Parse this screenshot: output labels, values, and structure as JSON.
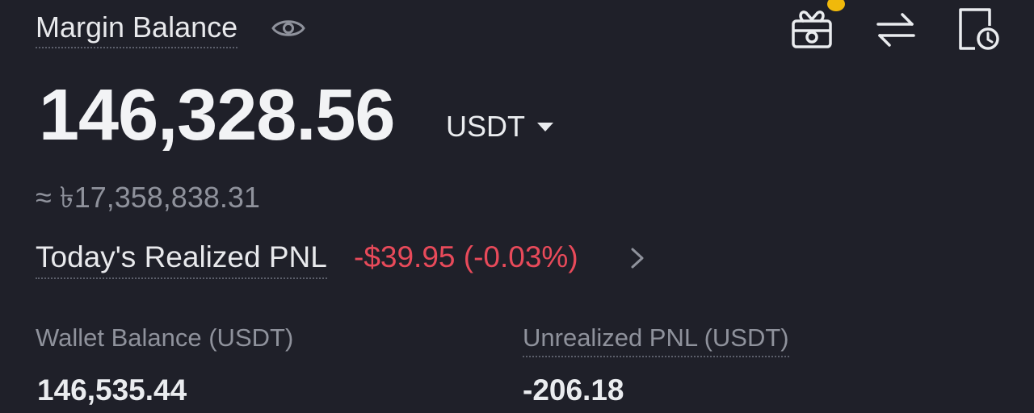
{
  "header": {
    "margin_balance_label": "Margin Balance",
    "notification_color": "#f0b90b"
  },
  "icons": {
    "visibility": "eye-icon",
    "rewards": "gift-icon",
    "transfer": "transfer-icon",
    "history": "history-icon",
    "currency_dropdown": "caret-down-icon",
    "pnl_details": "chevron-right-icon"
  },
  "balance": {
    "value": "146,328.56",
    "currency": "USDT",
    "approx_local": "≈ ৳17,358,838.31"
  },
  "pnl": {
    "label": "Today's Realized PNL",
    "value": "-$39.95 (-0.03%)",
    "color": "#e84a5a"
  },
  "stats": {
    "wallet_label": "Wallet Balance (USDT)",
    "wallet_value": "146,535.44",
    "unrealized_label": "Unrealized PNL (USDT)",
    "unrealized_value": "-206.18"
  }
}
